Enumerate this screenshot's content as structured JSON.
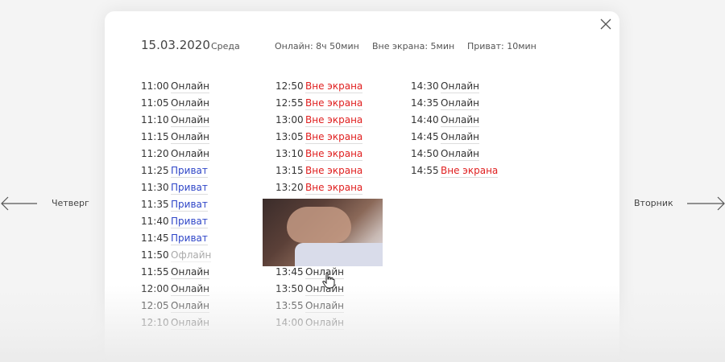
{
  "header": {
    "date": "15.03.2020",
    "weekday": "Среда",
    "online_stat": "Онлайн: 8ч 50мин",
    "away_stat": "Вне экрана: 5мин",
    "private_stat": "Приват: 10мин"
  },
  "nav": {
    "prev_label": "Четверг",
    "next_label": "Вторник"
  },
  "columns": [
    [
      {
        "time": "11:00",
        "status": "Онлайн",
        "kind": "online"
      },
      {
        "time": "11:05",
        "status": "Онлайн",
        "kind": "online"
      },
      {
        "time": "11:10",
        "status": "Онлайн",
        "kind": "online"
      },
      {
        "time": "11:15",
        "status": "Онлайн",
        "kind": "online"
      },
      {
        "time": "11:20",
        "status": "Онлайн",
        "kind": "online"
      },
      {
        "time": "11:25",
        "status": "Приват",
        "kind": "private"
      },
      {
        "time": "11:30",
        "status": "Приват",
        "kind": "private"
      },
      {
        "time": "11:35",
        "status": "Приват",
        "kind": "private"
      },
      {
        "time": "11:40",
        "status": "Приват",
        "kind": "private"
      },
      {
        "time": "11:45",
        "status": "Приват",
        "kind": "private"
      },
      {
        "time": "11:50",
        "status": "Офлайн",
        "kind": "offline"
      },
      {
        "time": "11:55",
        "status": "Онлайн",
        "kind": "online"
      },
      {
        "time": "12:00",
        "status": "Онлайн",
        "kind": "online"
      },
      {
        "time": "12:05",
        "status": "Онлайн",
        "kind": "online"
      },
      {
        "time": "12:10",
        "status": "Онлайн",
        "kind": "online"
      }
    ],
    [
      {
        "time": "12:50",
        "status": "Вне экрана",
        "kind": "away"
      },
      {
        "time": "12:55",
        "status": "Вне экрана",
        "kind": "away"
      },
      {
        "time": "13:00",
        "status": "Вне экрана",
        "kind": "away"
      },
      {
        "time": "13:05",
        "status": "Вне экрана",
        "kind": "away"
      },
      {
        "time": "13:10",
        "status": "Вне экрана",
        "kind": "away"
      },
      {
        "time": "13:15",
        "status": "Вне экрана",
        "kind": "away"
      },
      {
        "time": "13:20",
        "status": "Вне экрана",
        "kind": "away"
      },
      {
        "time": "",
        "status": "",
        "kind": "hidden"
      },
      {
        "time": "",
        "status": "",
        "kind": "hidden"
      },
      {
        "time": "",
        "status": "",
        "kind": "hidden"
      },
      {
        "time": "",
        "status": "",
        "kind": "hidden"
      },
      {
        "time": "13:45",
        "status": "Онлайн",
        "kind": "online"
      },
      {
        "time": "13:50",
        "status": "Онлайн",
        "kind": "online"
      },
      {
        "time": "13:55",
        "status": "Онлайн",
        "kind": "online"
      },
      {
        "time": "14:00",
        "status": "Онлайн",
        "kind": "online"
      }
    ],
    [
      {
        "time": "14:30",
        "status": "Онлайн",
        "kind": "online"
      },
      {
        "time": "14:35",
        "status": "Онлайн",
        "kind": "online"
      },
      {
        "time": "14:40",
        "status": "Онлайн",
        "kind": "online"
      },
      {
        "time": "14:45",
        "status": "Онлайн",
        "kind": "online"
      },
      {
        "time": "14:50",
        "status": "Онлайн",
        "kind": "online"
      },
      {
        "time": "14:55",
        "status": "Вне экрана",
        "kind": "away"
      }
    ]
  ],
  "colors": {
    "online": "#333333",
    "private": "#2f46c8",
    "away": "#e02020",
    "offline": "#aaaaaa"
  },
  "icons": {
    "close": "close-icon",
    "prev": "arrow-left-icon",
    "next": "arrow-right-icon",
    "cursor": "hand-pointer-icon"
  }
}
